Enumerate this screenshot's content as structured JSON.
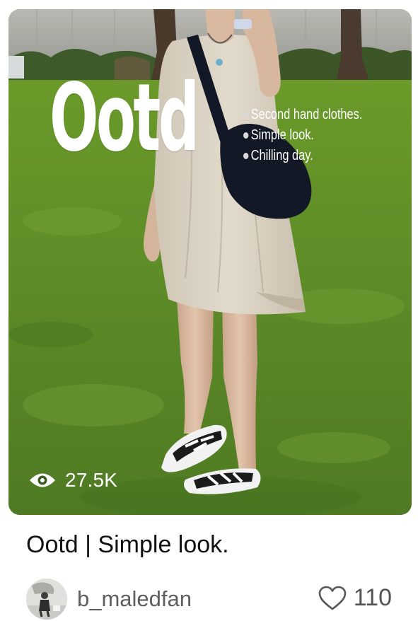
{
  "post": {
    "cover": {
      "overlay_title": "Ootd",
      "bullets": [
        "Second hand clothes.",
        "Simple look.",
        "Chilling day."
      ],
      "views": "27.5K",
      "view_icon": "eye-icon"
    },
    "title": "Ootd | Simple look.",
    "author": {
      "username": "b_maledfan",
      "avatar_icon": "avatar"
    },
    "likes": {
      "count": "110",
      "icon": "heart-outline-icon"
    }
  },
  "colors": {
    "grass": "#5f8a2e",
    "overlay_text": "#ffffff",
    "title_text": "#111111",
    "meta_text": "#5e5e5e"
  }
}
